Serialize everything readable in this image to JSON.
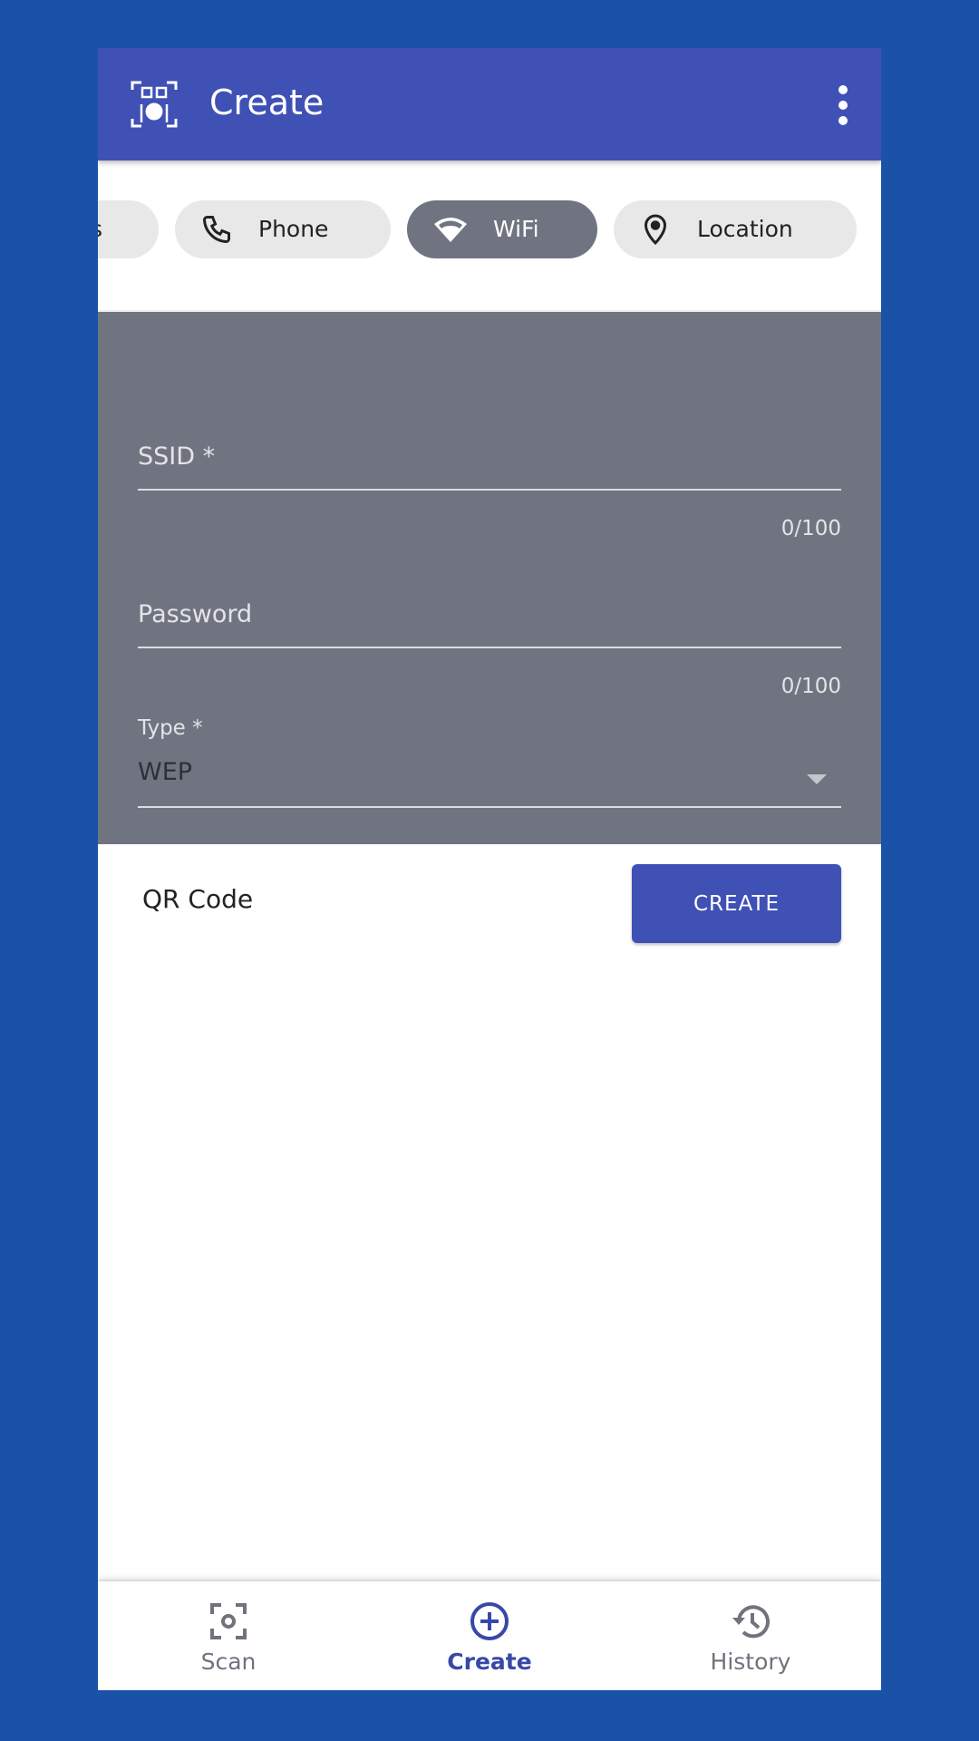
{
  "appbar": {
    "title": "Create",
    "logo_icon": "qr-restaurant-logo-icon",
    "menu_icon": "more-vertical-icon"
  },
  "chips": [
    {
      "label": "s",
      "icon": "text-icon",
      "active": false
    },
    {
      "label": "Phone",
      "icon": "phone-icon",
      "active": false
    },
    {
      "label": "WiFi",
      "icon": "wifi-icon",
      "active": true
    },
    {
      "label": "Location",
      "icon": "location-pin-icon",
      "active": false
    }
  ],
  "form": {
    "ssid": {
      "label": "SSID *",
      "value": "",
      "counter": "0/100"
    },
    "password": {
      "label": "Password",
      "value": "",
      "counter": "0/100"
    },
    "type": {
      "label": "Type *",
      "value": "WEP"
    }
  },
  "qr": {
    "label": "QR Code",
    "create_label": "CREATE"
  },
  "nav": [
    {
      "label": "Scan",
      "icon": "scan-icon",
      "active": false
    },
    {
      "label": "Create",
      "icon": "add-circle-icon",
      "active": true
    },
    {
      "label": "History",
      "icon": "history-icon",
      "active": false
    }
  ],
  "colors": {
    "primary": "#4051b5",
    "background": "#1a52a8",
    "form": "#6f7480",
    "chip": "#e8e8e8"
  }
}
